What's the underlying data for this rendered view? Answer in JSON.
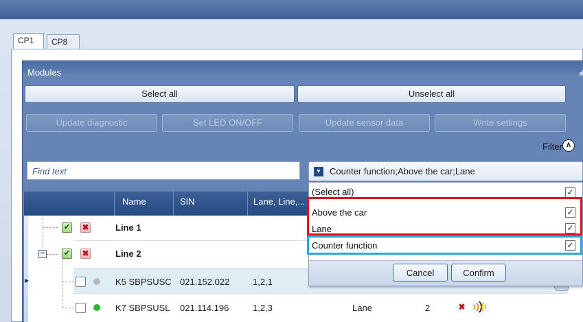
{
  "tabs": [
    "CP1",
    "CP8"
  ],
  "modules_panel": {
    "title": "Modules",
    "pin_icon": "pin-icon",
    "select_all": "Select all",
    "unselect_all": "Unselect all",
    "update_diagnostic": "Update diagnostic",
    "set_led": "Set LED ON/OFF",
    "update_sensor_data": "Update sensor data",
    "write_settings": "Write settings",
    "filter_label": "Filter",
    "find_placeholder": "Find text",
    "filter_combo_value": "Counter function;Above the car;Lane"
  },
  "grid": {
    "columns": [
      "Name",
      "SIN",
      "Lane, Line,..."
    ],
    "rows": [
      {
        "name": "Line 1"
      },
      {
        "name": "Line 2"
      },
      {
        "name": "K5 SBPSUSC",
        "sin": "021.152.022",
        "lane_line": "1,2,1",
        "status_color": "#b5b9bf"
      },
      {
        "name": "K7 SBPSUSL",
        "sin": "021.114.196",
        "lane_line": "1,2,3",
        "type": "Lane",
        "count": "2",
        "status_color": "#2fb52b"
      }
    ]
  },
  "filter_dropdown": {
    "items": [
      {
        "label": "(Select all)",
        "checked": true
      },
      {
        "label": "Above the car",
        "checked": true
      },
      {
        "label": "Lane",
        "checked": true
      },
      {
        "label": "Counter function",
        "checked": true
      }
    ],
    "cancel": "Cancel",
    "confirm": "Confirm"
  },
  "colors": {
    "highlight_red": "#e6121a",
    "highlight_blue": "#29a9e1",
    "header_blue": "#264a82"
  }
}
